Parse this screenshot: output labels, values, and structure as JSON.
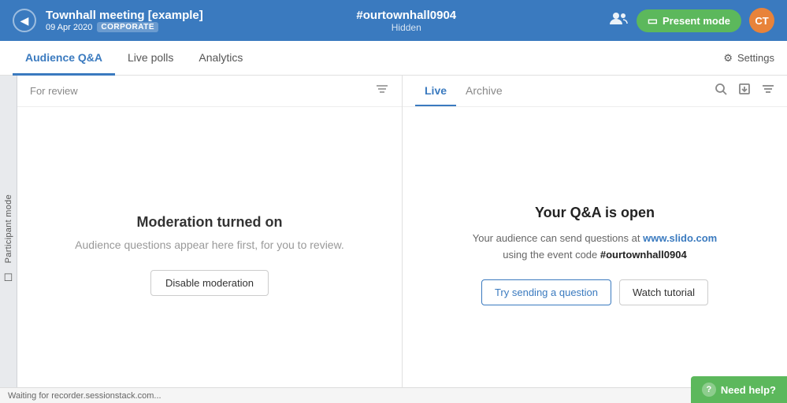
{
  "header": {
    "back_icon": "◀",
    "title": "Townhall meeting [example]",
    "date": "09 Apr 2020",
    "badge": "CORPORATE",
    "event_code": "#ourtownhall0904",
    "hidden_label": "Hidden",
    "present_mode_label": "Present mode",
    "avatar_initials": "CT",
    "monitor_icon": "▭"
  },
  "nav": {
    "tabs": [
      {
        "label": "Audience Q&A",
        "active": true
      },
      {
        "label": "Live polls",
        "active": false
      },
      {
        "label": "Analytics",
        "active": false
      }
    ],
    "settings_label": "Settings",
    "settings_icon": "⚙"
  },
  "participant_sidebar": {
    "label": "Participant mode",
    "phone_icon": "☐"
  },
  "left_panel": {
    "for_review_label": "For review",
    "filter_icon": "⇌",
    "moderation_title": "Moderation turned on",
    "moderation_desc": "Audience questions appear here first, for you to review.",
    "disable_btn_label": "Disable moderation"
  },
  "right_panel": {
    "tabs": [
      {
        "label": "Live",
        "active": true
      },
      {
        "label": "Archive",
        "active": false
      }
    ],
    "search_icon": "🔍",
    "download_icon": "⊞",
    "filter_icon": "≡",
    "qna_title": "Your Q&A is open",
    "qna_desc_before": "Your audience can send questions at ",
    "qna_website": "www.slido.com",
    "qna_desc_middle": "using the event code ",
    "qna_event_code": "#ourtownhall0904",
    "try_sending_label": "Try sending a question",
    "watch_tutorial_label": "Watch tutorial"
  },
  "status_bar": {
    "text": "Waiting for recorder.sessionstack.com..."
  },
  "need_help": {
    "icon": "?",
    "label": "Need help?"
  }
}
